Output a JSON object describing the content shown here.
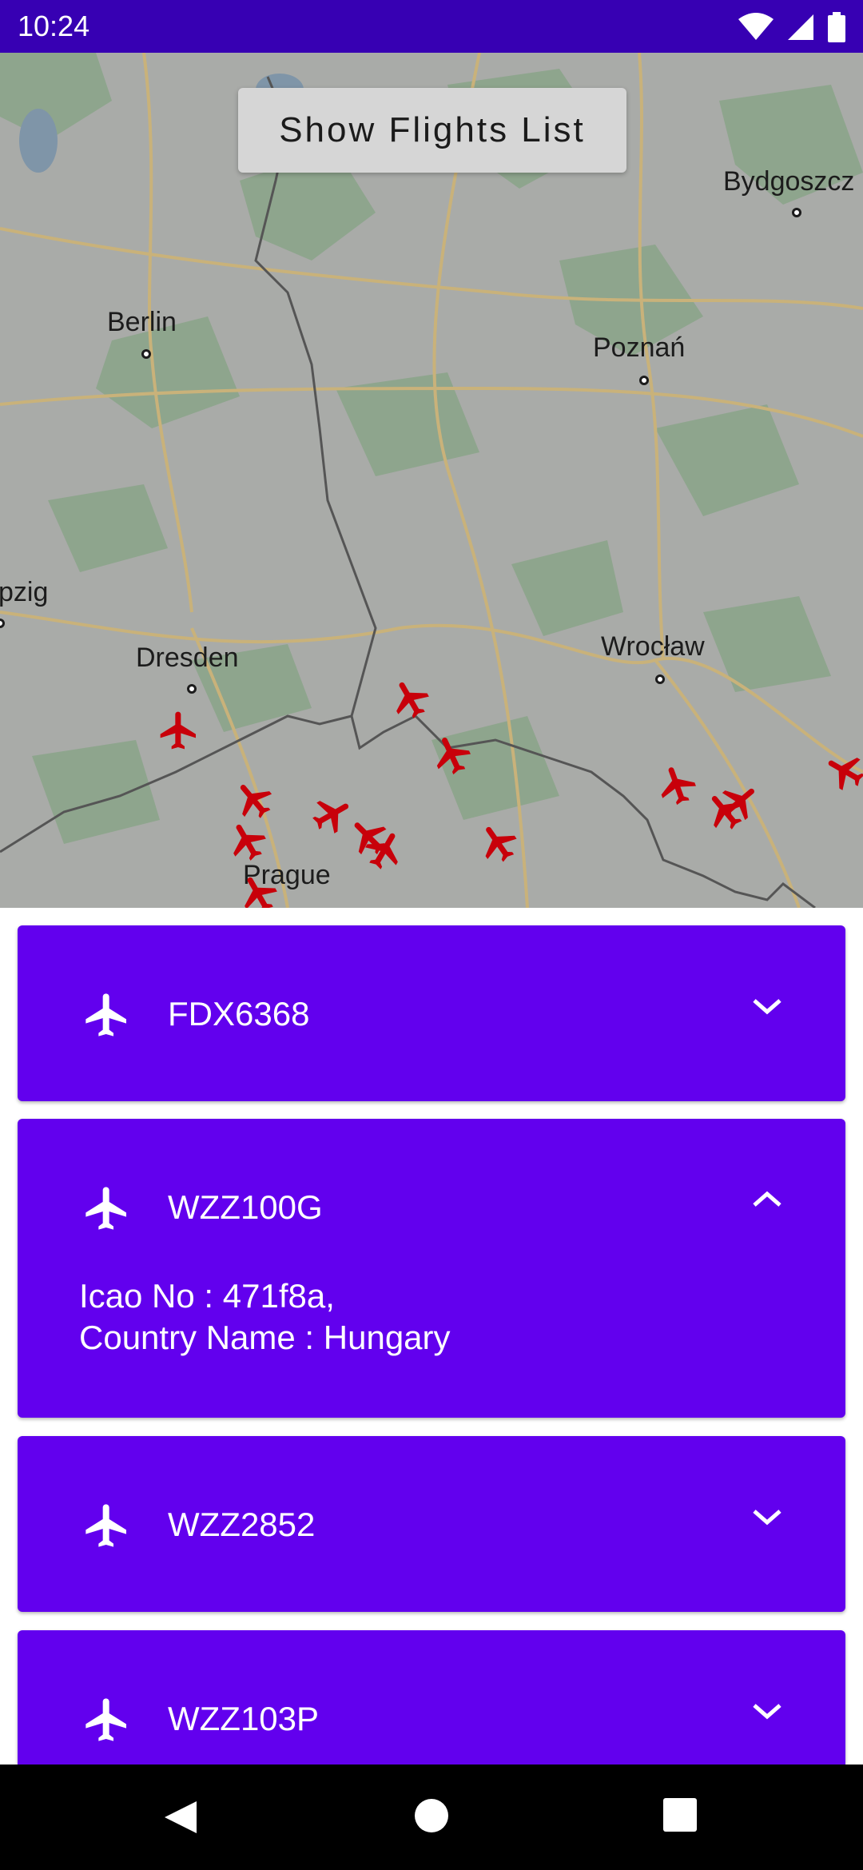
{
  "status_bar": {
    "time": "10:24",
    "icons": [
      "wifi-icon",
      "signal-icon",
      "battery-icon"
    ]
  },
  "map": {
    "show_button_label": "Show Flights List",
    "cities": [
      {
        "name": "Berlin"
      },
      {
        "name": "Poznań"
      },
      {
        "name": "Bydgoszcz"
      },
      {
        "name": "Dresden"
      },
      {
        "name": "Wrocław"
      },
      {
        "name": "Prague"
      },
      {
        "name": "pzig"
      }
    ],
    "plane_color": "#c8000a"
  },
  "flights": [
    {
      "code": "FDX6368",
      "expanded": false
    },
    {
      "code": "WZZ100G",
      "expanded": true,
      "icao_line": "Icao No : 471f8a,",
      "country_line": "Country Name : Hungary"
    },
    {
      "code": "WZZ2852",
      "expanded": false
    },
    {
      "code": "WZZ103P",
      "expanded": false
    }
  ],
  "colors": {
    "status_bar": "#3700b3",
    "card": "#6200ee",
    "nav_bar": "#000000"
  }
}
